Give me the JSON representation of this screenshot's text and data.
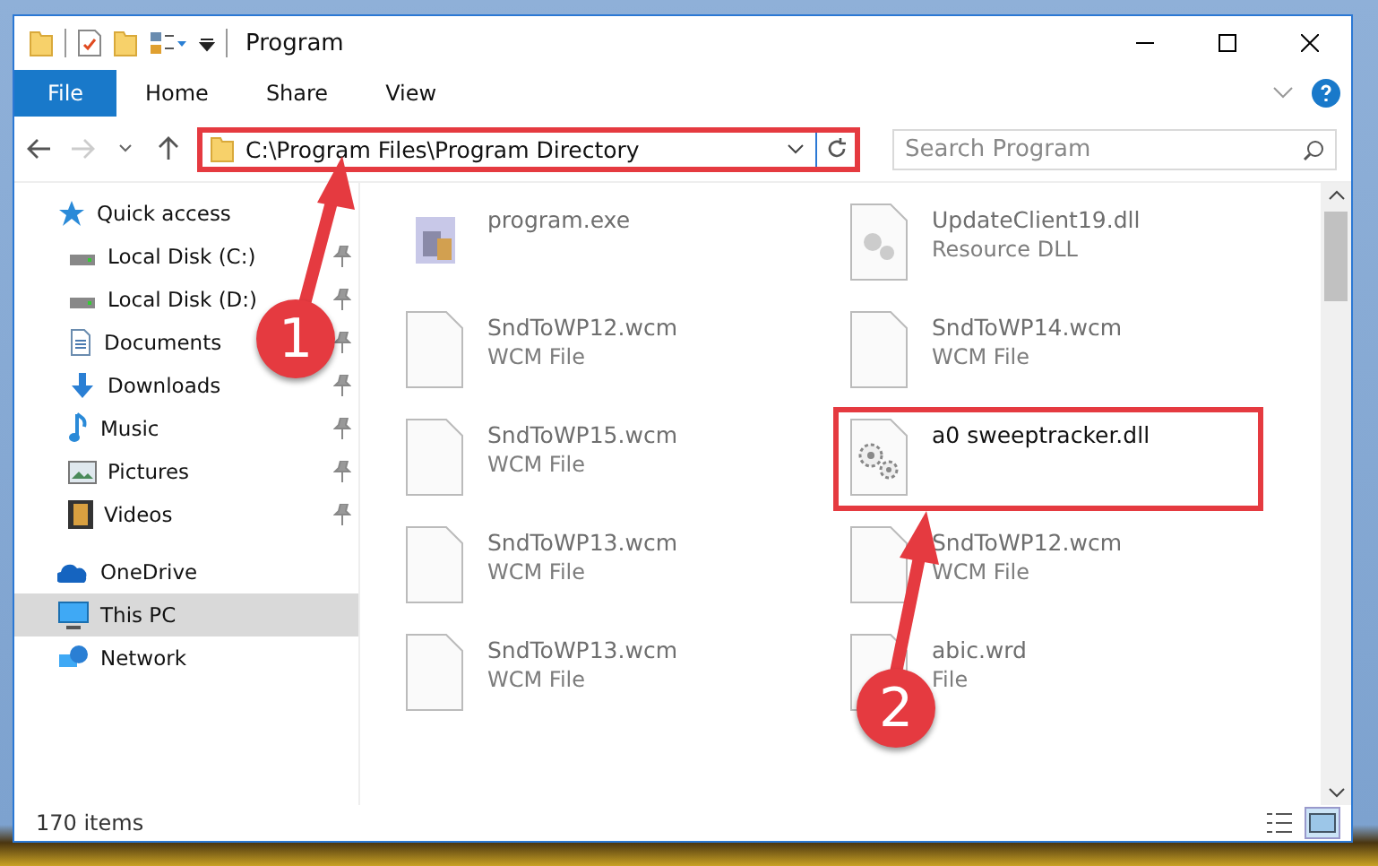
{
  "window": {
    "title": "Program"
  },
  "ribbon_tabs": [
    {
      "label": "File",
      "selected": true
    },
    {
      "label": "Home",
      "selected": false
    },
    {
      "label": "Share",
      "selected": false
    },
    {
      "label": "View",
      "selected": false
    }
  ],
  "address": {
    "path": "C:\\Program Files\\Program Directory",
    "highlighted": true
  },
  "search": {
    "placeholder": "Search Program"
  },
  "sidebar": {
    "items": [
      {
        "label": "Quick access",
        "kind": "star",
        "selected": false,
        "children": [
          {
            "label": "Local Disk (C:)",
            "kind": "drive",
            "pinned": true,
            "selected": false
          },
          {
            "label": "Local Disk (D:)",
            "kind": "drive",
            "pinned": true,
            "selected": false
          },
          {
            "label": "Documents",
            "kind": "documents",
            "pinned": true,
            "selected": false
          },
          {
            "label": "Downloads",
            "kind": "downloads",
            "pinned": true,
            "selected": false
          },
          {
            "label": "Music",
            "kind": "music",
            "pinned": true,
            "selected": false
          },
          {
            "label": "Pictures",
            "kind": "pictures",
            "pinned": true,
            "selected": false
          },
          {
            "label": "Videos",
            "kind": "videos",
            "pinned": true,
            "selected": false
          }
        ]
      },
      {
        "label": "OneDrive",
        "kind": "cloud",
        "selected": false
      },
      {
        "label": "This PC",
        "kind": "pc",
        "selected": true
      },
      {
        "label": "Network",
        "kind": "network",
        "selected": false
      }
    ]
  },
  "files": [
    {
      "name": "program.exe",
      "kind": "exe",
      "blurred": true,
      "highlighted": false
    },
    {
      "name": "UpdateClient19.dll",
      "type": "Resource DLL",
      "kind": "dll",
      "blurred": true,
      "highlighted": false
    },
    {
      "name": "SndToWP12.wcm",
      "type": "WCM File",
      "kind": "blank",
      "blurred": true,
      "highlighted": false
    },
    {
      "name": "SndToWP14.wcm",
      "type": "WCM File",
      "kind": "blank",
      "blurred": true,
      "highlighted": false
    },
    {
      "name": "SndToWP15.wcm",
      "type": "WCM File",
      "kind": "blank",
      "blurred": true,
      "highlighted": false
    },
    {
      "name": "a0 sweeptracker.dll",
      "kind": "gear",
      "blurred": false,
      "highlighted": true
    },
    {
      "name": "SndToWP13.wcm",
      "type": "WCM File",
      "kind": "blank",
      "blurred": true,
      "highlighted": false
    },
    {
      "name": "SndToWP12.wcm",
      "type": "WCM File",
      "kind": "blank",
      "blurred": true,
      "highlighted": false
    },
    {
      "name": "SndToWP13.wcm",
      "type": "WCM File",
      "kind": "blank",
      "blurred": true,
      "highlighted": false
    },
    {
      "name": "abic.wrd",
      "type": "File",
      "kind": "blank",
      "blurred": true,
      "highlighted": false
    }
  ],
  "status_bar": {
    "count": "170 items"
  },
  "view_buttons": [
    {
      "kind": "details",
      "selected": false
    },
    {
      "kind": "large",
      "selected": true
    }
  ],
  "callouts": [
    {
      "number": "1"
    },
    {
      "number": "2"
    }
  ]
}
